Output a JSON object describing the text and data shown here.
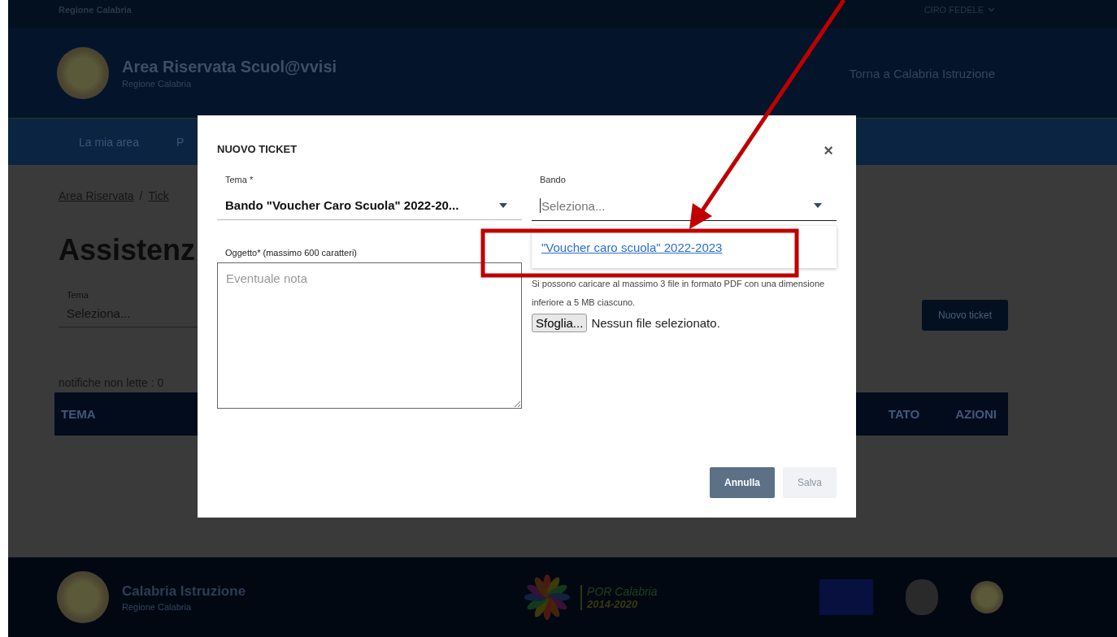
{
  "top_bar": {
    "region": "Regione Calabria",
    "user": "CIRO FEDELE"
  },
  "header": {
    "title": "Area Riservata Scuol@vvisi",
    "subtitle": "Regione Calabria",
    "link": "Torna a Calabria Istruzione"
  },
  "nav": {
    "items": [
      {
        "label": "La mia area"
      },
      {
        "label": "P"
      }
    ]
  },
  "breadcrumb": {
    "items": [
      "Area Riservata",
      "Tick"
    ],
    "separator": "/"
  },
  "page_title": "Assistenz",
  "filter": {
    "label": "Tema",
    "placeholder": "Seleziona..."
  },
  "new_ticket_button": "Nuovo ticket",
  "unread": "notifiche non lette : 0",
  "table": {
    "columns": [
      "TEMA",
      "TATO",
      "AZIONI"
    ]
  },
  "footer": {
    "title": "Calabria Istruzione",
    "subtitle": "Regione Calabria",
    "por_title": "POR Calabria",
    "por_years": "2014-2020"
  },
  "modal": {
    "title": "NUOVO TICKET",
    "close": "×",
    "tema": {
      "label": "Tema *",
      "value": "Bando \"Voucher Caro Scuola\" 2022-20..."
    },
    "bando": {
      "label": "Bando",
      "placeholder": "Seleziona...",
      "expanded": true,
      "options": [
        {
          "label": "\"Voucher caro scuola\" 2022-2023"
        }
      ]
    },
    "oggetto": {
      "label": "Oggetto* (massimo 600 caratteri)",
      "placeholder": "Eventuale nota"
    },
    "upload_hint": "Si possono caricare al massimo 3 file in formato PDF con una dimensione inferiore a 5 MB ciascuno.",
    "browse_button": "Sfoglia...",
    "no_file": "Nessun file selezionato.",
    "buttons": [
      {
        "label": "Annulla",
        "disabled": false
      },
      {
        "label": "Salva",
        "disabled": true
      }
    ]
  }
}
